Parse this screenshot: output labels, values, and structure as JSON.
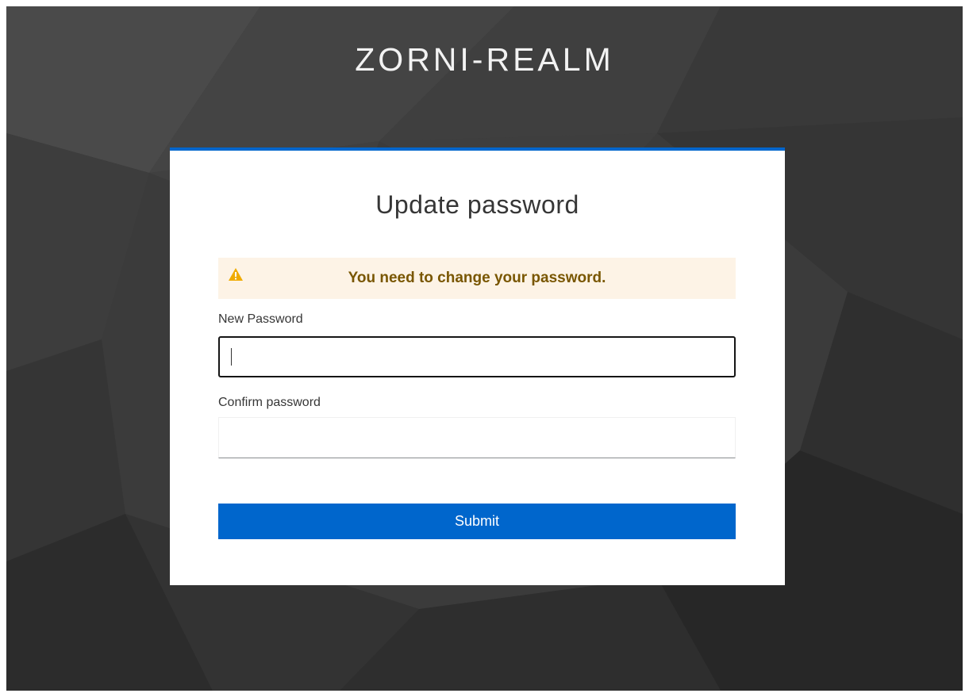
{
  "realm": {
    "title": "ZORNI-REALM"
  },
  "card": {
    "title": "Update password",
    "accent_color": "#0066cc"
  },
  "alert": {
    "icon": "warning-triangle-icon",
    "message": "You need to change your password.",
    "background": "#fdf3e6",
    "text_color": "#795600"
  },
  "form": {
    "new_password": {
      "label": "New Password",
      "value": ""
    },
    "confirm_password": {
      "label": "Confirm password",
      "value": ""
    },
    "submit_label": "Submit"
  }
}
